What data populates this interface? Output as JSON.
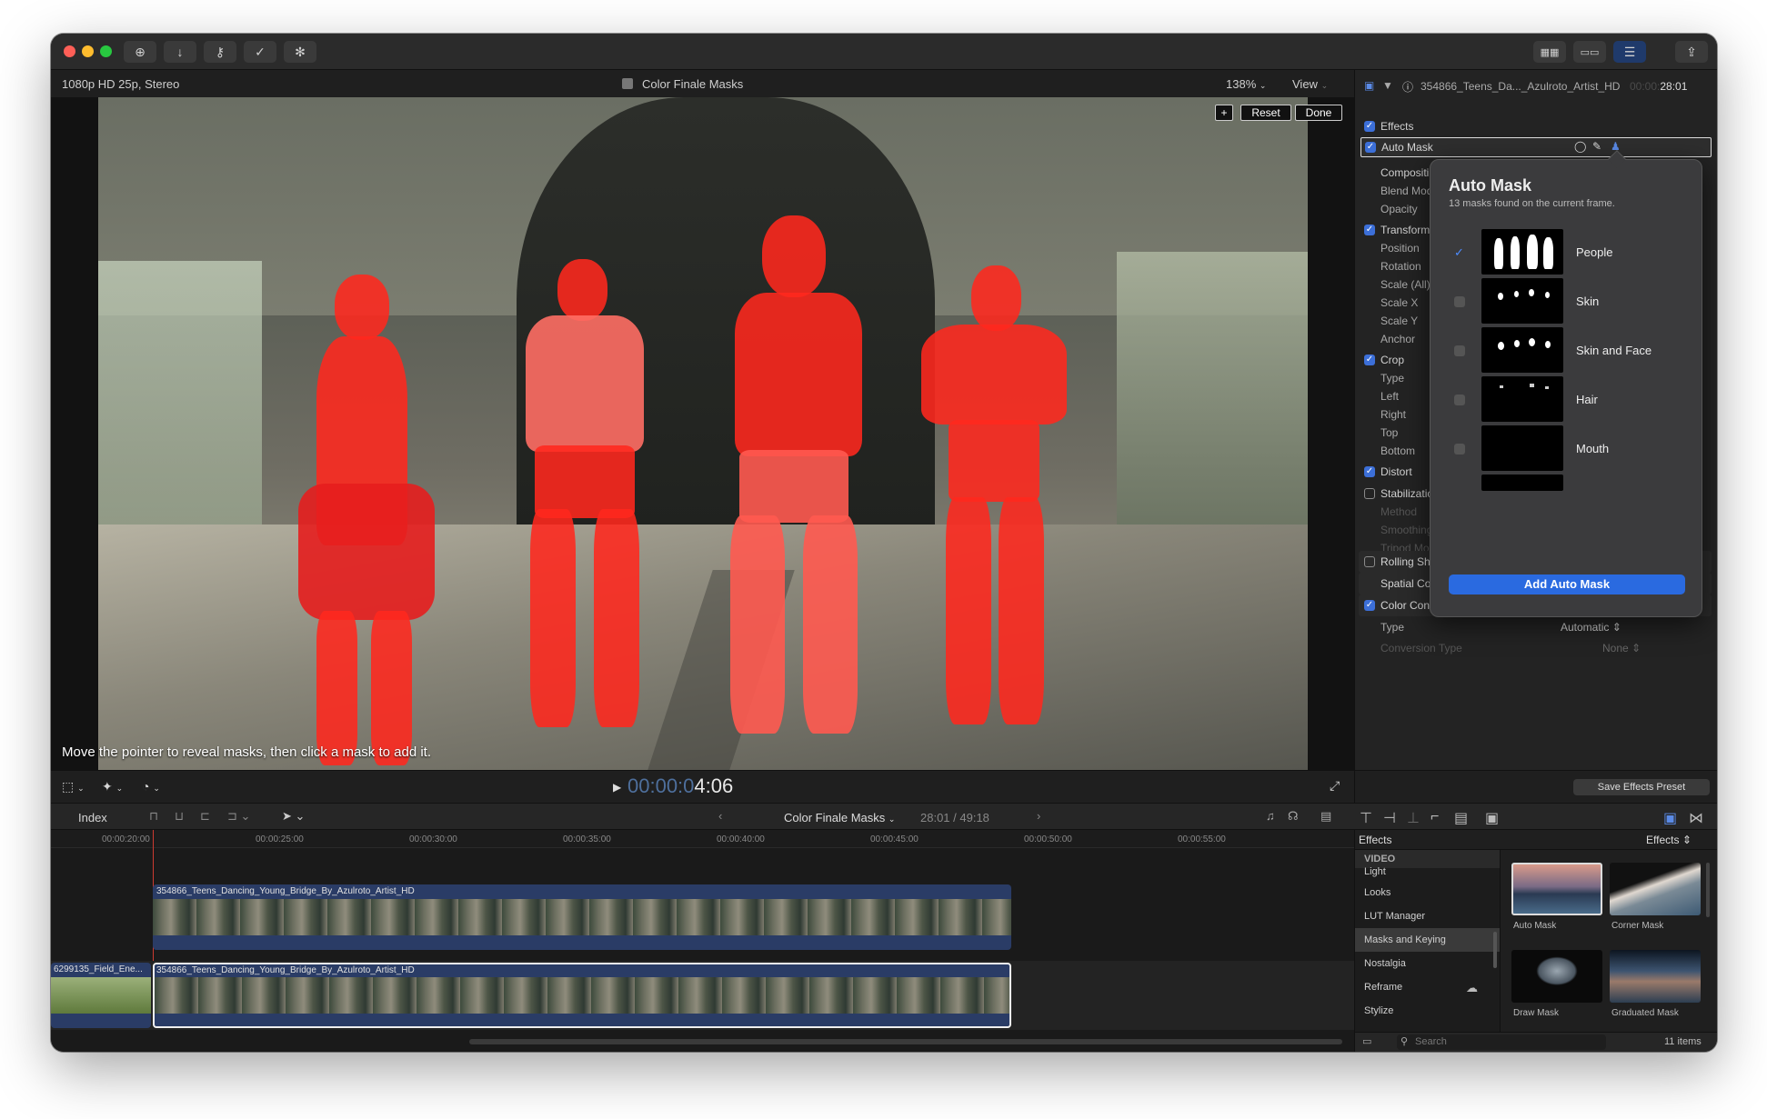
{
  "toolbar": {
    "buttons": [
      "plus-circle-icon",
      "download-icon",
      "key-icon",
      "checkmark-circle-icon",
      "snowflake-icon"
    ],
    "right_buttons": [
      "grid-icon",
      "filmstrip-icon",
      "sliders-icon",
      "share-icon"
    ]
  },
  "viewer": {
    "format": "1080p HD 25p, Stereo",
    "title": "Color Finale Masks",
    "zoom": "138%",
    "view_label": "View",
    "plus_label": "+",
    "reset_label": "Reset",
    "done_label": "Done",
    "hint": "Move the pointer to reveal masks, then click a mask to add it.",
    "timecode_dim": "00:00:0",
    "timecode": "4:06"
  },
  "inspector": {
    "clip_name": "354866_Teens_Da..._Azulroto_Artist_HD",
    "duration_dim": "00:00:",
    "duration": "28:01",
    "effects_label": "Effects",
    "auto_mask_label": "Auto Mask",
    "compositing_label": "Compositin",
    "blend_mode_label": "Blend Mod",
    "opacity_label": "Opacity",
    "transform_label": "Transform",
    "transform_items": [
      "Position",
      "Rotation",
      "Scale (All)",
      "Scale X",
      "Scale Y",
      "Anchor"
    ],
    "crop_label": "Crop",
    "crop_items": [
      "Type",
      "Left",
      "Right",
      "Top",
      "Bottom"
    ],
    "distort_label": "Distort",
    "stabilization_label": "Stabilizatic",
    "stabilization_items": [
      "Method",
      "Smoothing",
      "Tripod Mode"
    ],
    "rolling_shutter_label": "Rolling Shutter",
    "spatial_conform_label": "Spatial Conform",
    "color_conform_label": "Color Conform",
    "cc_type_label": "Type",
    "cc_type_value": "Automatic",
    "conversion_type_label": "Conversion Type",
    "conversion_type_value": "None",
    "save_preset_label": "Save Effects Preset"
  },
  "popover": {
    "title": "Auto Mask",
    "subtitle": "13 masks found on the current frame.",
    "masks": [
      {
        "label": "People",
        "checked": true
      },
      {
        "label": "Skin",
        "checked": false
      },
      {
        "label": "Skin and Face",
        "checked": false
      },
      {
        "label": "Hair",
        "checked": false
      },
      {
        "label": "Mouth",
        "checked": false
      }
    ],
    "add_button": "Add Auto Mask"
  },
  "timeline": {
    "index_label": "Index",
    "project_title": "Color Finale Masks",
    "position": "28:01 / 49:18",
    "ruler": [
      "00:00:20:00",
      "00:00:25:00",
      "00:00:30:00",
      "00:00:35:00",
      "00:00:40:00",
      "00:00:45:00",
      "00:00:50:00",
      "00:00:55:00"
    ],
    "clip_top": "354866_Teens_Dancing_Young_Bridge_By_Azulroto_Artist_HD",
    "clip_bottom": "354866_Teens_Dancing_Young_Bridge_By_Azulroto_Artist_HD",
    "clip_left": "6299135_Field_Ene..."
  },
  "effects_browser": {
    "header_left": "Effects",
    "header_right": "Effects",
    "category_header": "VIDEO",
    "categories": [
      "Light",
      "Looks",
      "LUT Manager",
      "Masks and Keying",
      "Nostalgia",
      "Reframe",
      "Stylize"
    ],
    "selected_category": "Masks and Keying",
    "effects": [
      "Auto Mask",
      "Corner Mask",
      "Draw Mask",
      "Graduated Mask"
    ],
    "search_placeholder": "Search",
    "count": "11 items"
  }
}
